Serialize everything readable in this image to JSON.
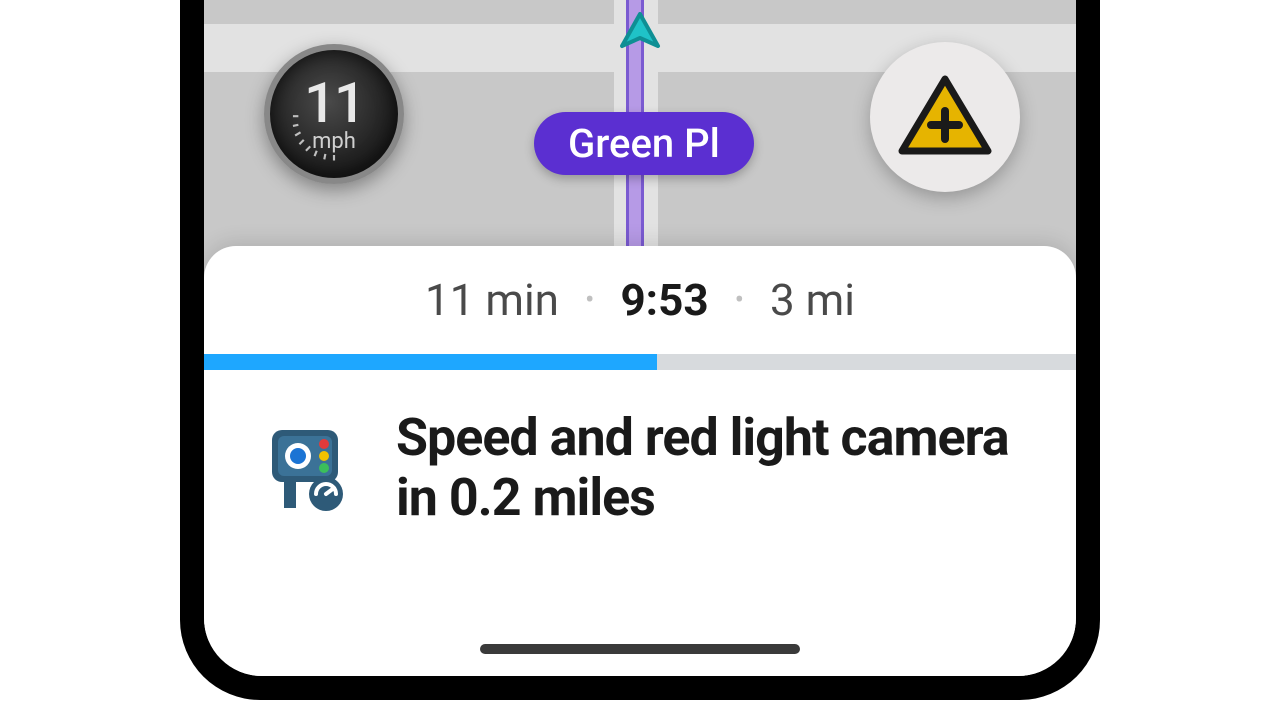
{
  "speedometer": {
    "value": "11",
    "unit": "mph"
  },
  "street": {
    "name": "Green Pl"
  },
  "eta": {
    "remaining": "11 min",
    "arrival": "9:53",
    "distance": "3 mi"
  },
  "progress": {
    "percent": 52
  },
  "alert": {
    "text": "Speed and red light camera in 0.2 miles"
  },
  "colors": {
    "route": "#b69ae6",
    "pill": "#5b2fd1",
    "progress": "#1ea7ff",
    "report_triangle": "#e6b400"
  }
}
